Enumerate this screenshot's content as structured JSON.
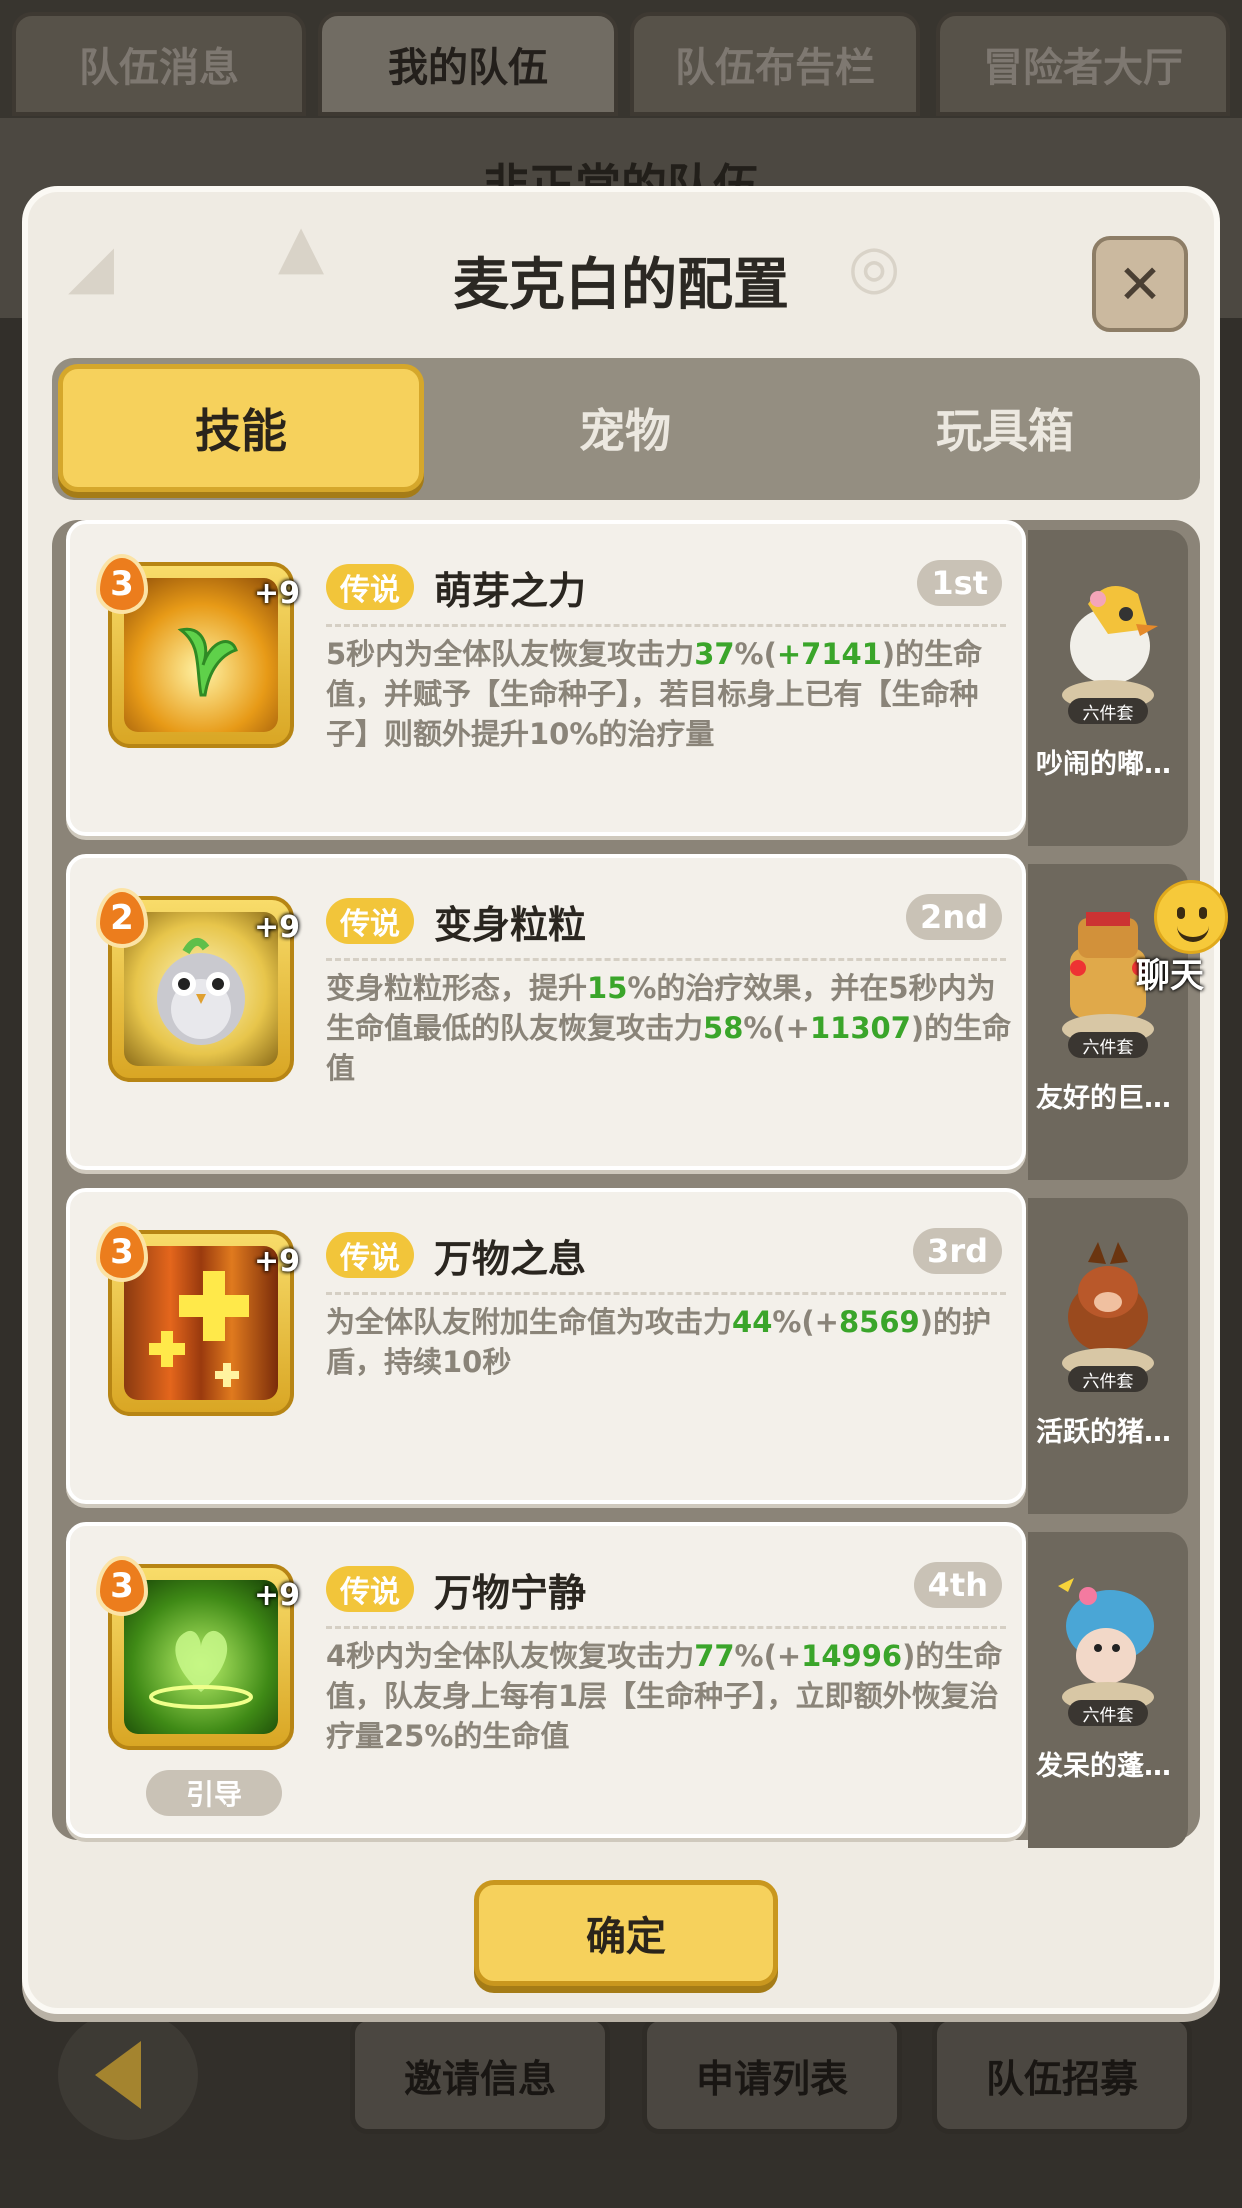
{
  "top_tabs": [
    "队伍消息",
    "我的队伍",
    "队伍布告栏",
    "冒险者大厅"
  ],
  "background_title": "非正常的队伍",
  "dialog": {
    "title": "麦克白的配置",
    "close_icon": "close-icon",
    "tabs": [
      "技能",
      "宠物",
      "玩具箱"
    ],
    "confirm_label": "确定"
  },
  "skills": [
    {
      "level": "3",
      "plus": "+9",
      "tag": "传说",
      "name": "萌芽之力",
      "rank": "1st",
      "desc_parts": [
        "5秒内为全体队友恢复攻击力",
        "37",
        "%(",
        "+7141",
        ")的生命值，并赋予【生命种子】，若目标身上已有【生命种子】则额外提升10%的治疗量"
      ],
      "pet": {
        "set": "六件套",
        "name": "吵闹的嘟…"
      }
    },
    {
      "level": "2",
      "plus": "+9",
      "tag": "传说",
      "name": "变身粒粒",
      "rank": "2nd",
      "desc_parts": [
        "变身粒粒形态，提升",
        "15",
        "%的治疗效果，并在5秒内为生命值最低的队友恢复攻击力",
        "58",
        "%(+",
        "11307",
        ")的生命值"
      ],
      "pet": {
        "set": "六件套",
        "name": "友好的巨…"
      }
    },
    {
      "level": "3",
      "plus": "+9",
      "tag": "传说",
      "name": "万物之息",
      "rank": "3rd",
      "desc_parts": [
        "为全体队友附加生命值为攻击力",
        "44",
        "%(+",
        "8569",
        ")的护盾，持续10秒"
      ],
      "pet": {
        "set": "六件套",
        "name": "活跃的猪…"
      }
    },
    {
      "level": "3",
      "plus": "+9",
      "tag": "传说",
      "name": "万物宁静",
      "rank": "4th",
      "guide": "引导",
      "desc_parts": [
        "4秒内为全体队友恢复攻击力",
        "77",
        "%(+",
        "14996",
        ")的生命值，队友身上每有1层【生命种子】，立即额外恢复治疗量25%的生命值"
      ],
      "pet": {
        "set": "六件套",
        "name": "发呆的蓬…"
      }
    }
  ],
  "chat_label": "聊天",
  "bottom_buttons": [
    "邀请信息",
    "申请列表",
    "队伍招募"
  ],
  "colors": {
    "accent_yellow": "#f6d15c",
    "highlight_green": "#3aa52a",
    "legend_tag": "#f2c53a"
  }
}
